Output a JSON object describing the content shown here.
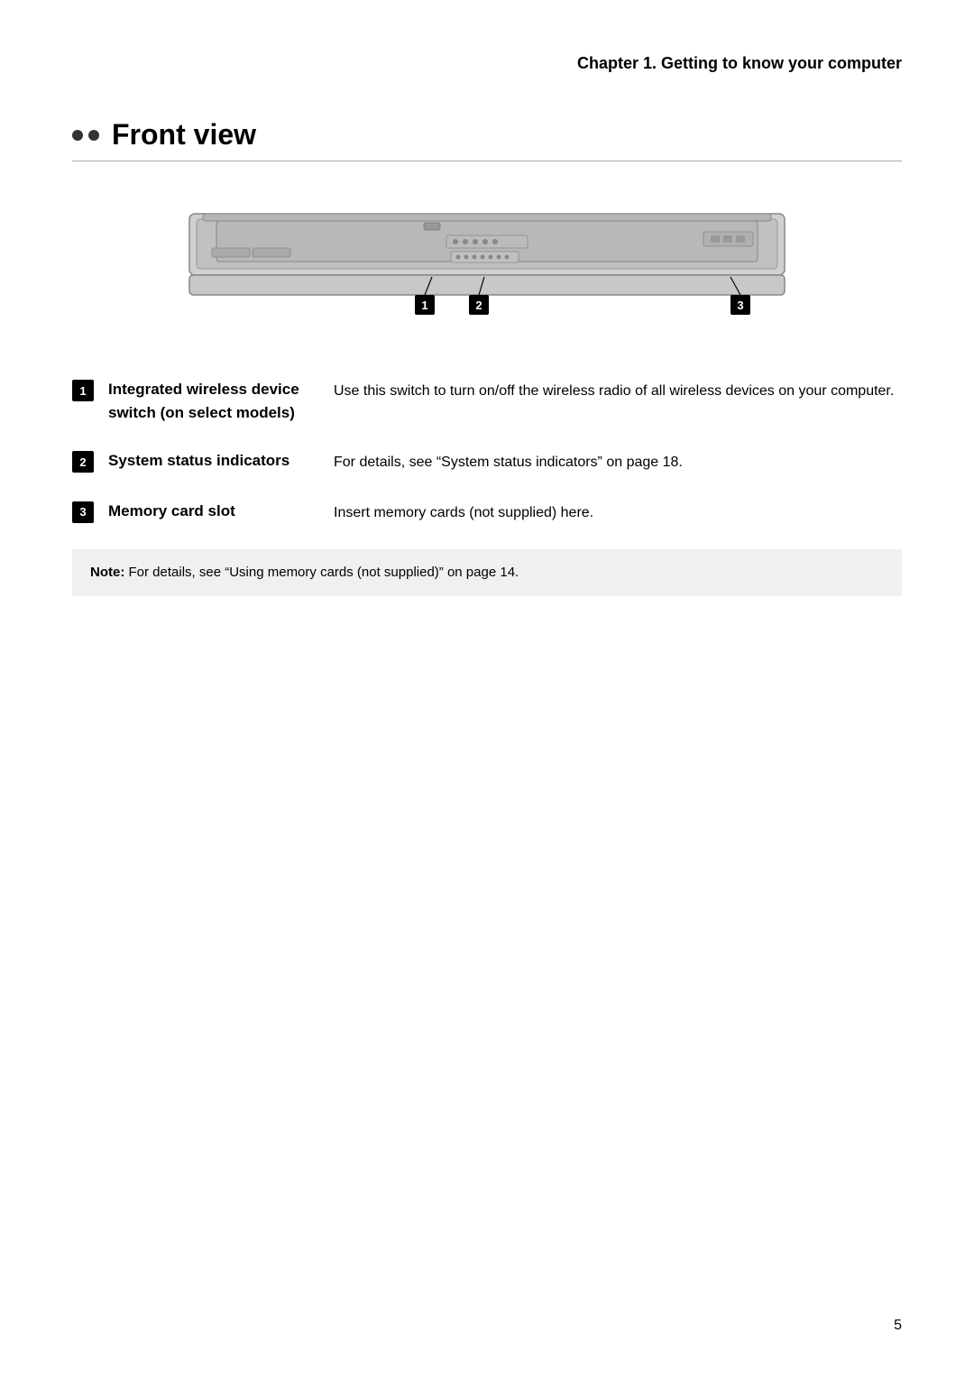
{
  "chapter": {
    "title": "Chapter 1. Getting to know your computer"
  },
  "section": {
    "title": "Front view",
    "dots_count": 2
  },
  "diagram": {
    "label": "Front view diagram of laptop"
  },
  "items": [
    {
      "number": "1",
      "term": "Integrated wireless device switch (on select models)",
      "description": "Use this switch to turn on/off the wireless radio of all wireless devices on your computer."
    },
    {
      "number": "2",
      "term": "System status indicators",
      "description": "For details, see “System status indicators” on page 18."
    },
    {
      "number": "3",
      "term": "Memory card slot",
      "description": "Insert memory cards (not supplied) here."
    }
  ],
  "note": {
    "label": "Note:",
    "text": "For details, see “Using memory cards (not supplied)” on page 14."
  },
  "page_number": "5"
}
